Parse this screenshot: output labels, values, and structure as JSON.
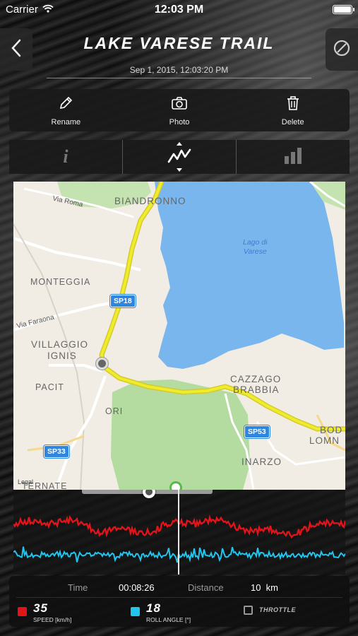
{
  "status_bar": {
    "carrier": "Carrier",
    "time": "12:03 PM"
  },
  "header": {
    "title": "LAKE VARESE TRAIL",
    "date": "Sep 1, 2015, 12:03:20 PM",
    "back_icon": "chevron-left-icon",
    "settings_icon": "no-entry-icon"
  },
  "actions": [
    {
      "label": "Rename",
      "icon": "pencil-icon"
    },
    {
      "label": "Photo",
      "icon": "camera-icon"
    },
    {
      "label": "Delete",
      "icon": "trash-icon"
    }
  ],
  "tabs": [
    {
      "label": "i",
      "icon": "info-icon",
      "selected": false
    },
    {
      "label": "",
      "icon": "graph-icon",
      "selected": true
    },
    {
      "label": "",
      "icon": "bar-chart-icon",
      "selected": false
    }
  ],
  "map": {
    "places": [
      "BIANDRONNO",
      "MONTEGGIA",
      "VILLAGGIO",
      "IGNIS",
      "PACIT",
      "ORI",
      "CAZZAGO",
      "BRABBIA",
      "INARZO",
      "BOD",
      "LOMN",
      "TERNATE"
    ],
    "roads": [
      "Via Roma",
      "Via Faraona"
    ],
    "lake_label": [
      "Lago di",
      "Varese"
    ],
    "shields": [
      "SP18",
      "SP53",
      "SP33"
    ],
    "legal": "Legal",
    "colors": {
      "lake": "#7ab6ee",
      "park": "#b5dca0",
      "route": "#eded2d",
      "land": "#f1ede5"
    }
  },
  "graph": {
    "speed_color": "#e0141a",
    "roll_color": "#23c4ee"
  },
  "stats": {
    "time_label": "Time",
    "time_value": "00:08:26",
    "distance_label": "Distance",
    "distance_value": "10  km",
    "speed_value": "35",
    "speed_unit": "SPEED [km/h]",
    "roll_value": "18",
    "roll_unit": "ROLL ANGLE [°]",
    "throttle_label": "THROTTLE",
    "throttle_checked": false
  }
}
